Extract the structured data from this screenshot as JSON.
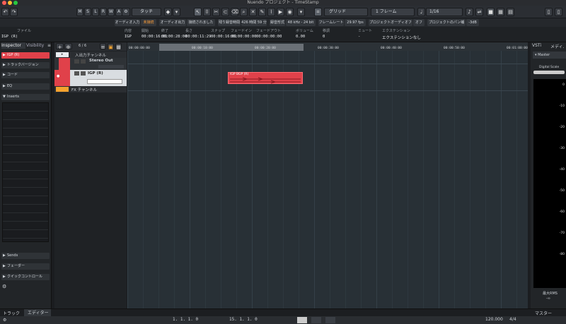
{
  "window": {
    "title": "Nuendo プロジェクト - TimeStamp"
  },
  "toolbar": {
    "mode_buttons": [
      "M",
      "S",
      "L",
      "R",
      "W",
      "A"
    ],
    "automation_mode": "タッチ",
    "snap_type": "グリッド",
    "quantize_unit": "1 フレーム",
    "quantize_value": "1/16"
  },
  "infobar": {
    "audio_input_label": "オーディオ入力",
    "audio_input_status": "未接続",
    "audio_output_label": "オーディオ出力",
    "audio_output_status": "接続されました",
    "record_time_label": "残り録音時間",
    "record_time_value": "426 時間 59 分",
    "record_format_label": "録音形式",
    "record_format_value": "48 kHz - 24 bit",
    "frame_rate_label": "フレームレート",
    "frame_rate_value": "29.97 fps",
    "offline_label": "プロジェクトオーディオフル",
    "offline_value": "オフ",
    "pan_label": "プロジェクトのパン補正",
    "pan_value": "-3dB"
  },
  "infoline": {
    "headers": [
      "ファイル",
      "内容",
      "開始",
      "終了",
      "長さ",
      "スナップ",
      "フェードイン",
      "フェードアウト",
      "ボリューム",
      "移調",
      "ミュート",
      "エクステンション"
    ],
    "values": [
      "IGP (R)",
      "IGP",
      "00:00:16:01",
      "00:00:28:00",
      "00:00:11:29",
      "00:00:16:01",
      "00:00:00:00",
      "00:00:00:00",
      "0.00",
      "0",
      "-",
      "エクステンションなし"
    ],
    "left_value": "IGP (R)"
  },
  "inspector": {
    "tabs": [
      "Inspector",
      "Visibility"
    ],
    "track_name": "IGP (R)",
    "sections": [
      "トラックバージョン",
      "コード",
      "EQ",
      "Inserts"
    ],
    "bottom_sections": [
      "Sends",
      "フェーダー",
      "クイックコントロール"
    ]
  },
  "tracklist": {
    "count": "6 / 6",
    "tracks": [
      {
        "name": "入出力チャンネル",
        "type": "folder"
      },
      {
        "name": "Stereo Out",
        "type": "output"
      },
      {
        "name": "IGP (R)",
        "type": "audio"
      },
      {
        "name": "FX チャンネル",
        "type": "folder"
      }
    ]
  },
  "ruler": {
    "ticks": [
      "00:00:00:00",
      "00:00:10:00",
      "00:00:20:00",
      "00:00:30:00",
      "00:00:40:00",
      "00:00:50:00",
      "00:01:00:00"
    ]
  },
  "event": {
    "name": "IGP BGP (R)"
  },
  "right_panel": {
    "tab": "VSTi",
    "tab2": "メディ.",
    "master_label": "Master",
    "scale_label": "Digital Scale",
    "scale_values": [
      "0",
      "-10",
      "-20",
      "-30",
      "-40",
      "-50",
      "-60",
      "-70",
      "-80"
    ],
    "rms_label": "最大RMS",
    "rms_value": "-∞"
  },
  "bottom_tabs": {
    "left": [
      "トラック",
      "エディター"
    ],
    "right": "マスター"
  },
  "transport": {
    "position": "1. 1. 1. 0",
    "locator": "15. 1. 1. 0",
    "tempo": "120.000",
    "signature": "4/4"
  },
  "colors": {
    "accent": "#e0414a",
    "bg": "#283036"
  }
}
